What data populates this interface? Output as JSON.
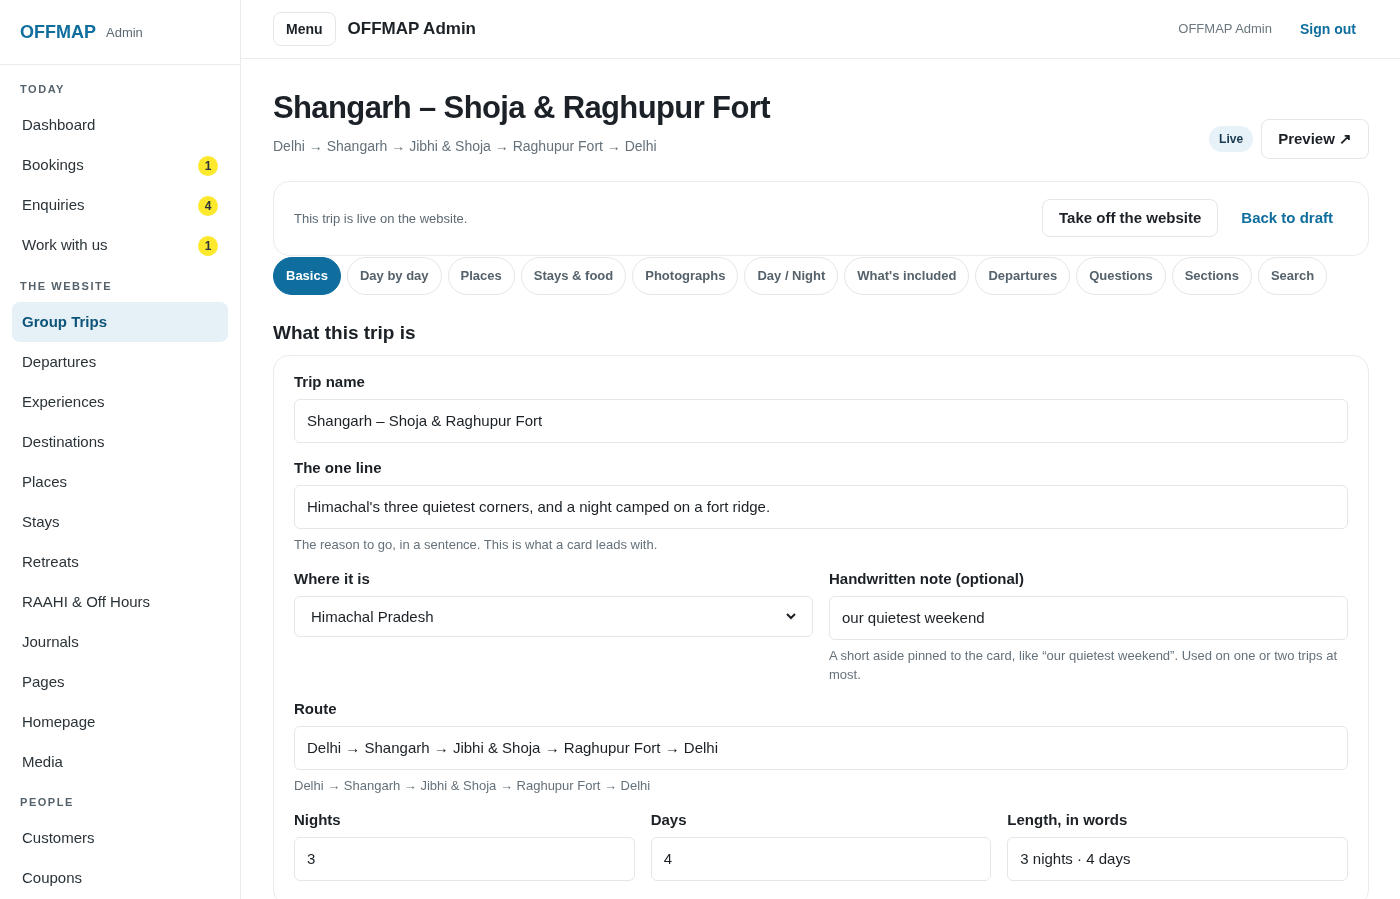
{
  "sidebar": {
    "brand": "OFFMAP",
    "brand_suffix": "Admin",
    "groups": [
      {
        "heading": "TODAY",
        "items": [
          {
            "label": "Dashboard",
            "selected": false
          },
          {
            "label": "Bookings",
            "badge": "1",
            "selected": false
          },
          {
            "label": "Enquiries",
            "badge": "4",
            "selected": false
          },
          {
            "label": "Work with us",
            "badge": "1",
            "selected": false
          }
        ]
      },
      {
        "heading": "THE WEBSITE",
        "items": [
          {
            "label": "Group Trips",
            "selected": true
          },
          {
            "label": "Departures",
            "selected": false
          },
          {
            "label": "Experiences",
            "selected": false
          },
          {
            "label": "Destinations",
            "selected": false
          },
          {
            "label": "Places",
            "selected": false
          },
          {
            "label": "Stays",
            "selected": false
          },
          {
            "label": "Retreats",
            "selected": false
          },
          {
            "label": "RAAHI & Off Hours",
            "selected": false
          },
          {
            "label": "Journals",
            "selected": false
          },
          {
            "label": "Pages",
            "selected": false
          },
          {
            "label": "Homepage",
            "selected": false
          },
          {
            "label": "Media",
            "selected": false
          }
        ]
      },
      {
        "heading": "PEOPLE",
        "items": [
          {
            "label": "Customers",
            "selected": false
          },
          {
            "label": "Coupons",
            "selected": false
          }
        ]
      }
    ]
  },
  "topbar": {
    "menu_button": "Menu",
    "title": "OFFMAP Admin",
    "user": "OFFMAP Admin",
    "sign_out": "Sign out"
  },
  "page": {
    "title": "Shangarh – Shoja & Raghupur Fort",
    "route": "Delhi → Shangarh → Jibhi & Shoja → Raghupur Fort → Delhi",
    "status_badge": "Live",
    "preview_button": "Preview ↗"
  },
  "status_card": {
    "message": "This trip is live on the website.",
    "primary_button": "Take off the website",
    "link_button": "Back to draft"
  },
  "tabs": [
    {
      "label": "Basics",
      "selected": true
    },
    {
      "label": "Day by day",
      "selected": false
    },
    {
      "label": "Places",
      "selected": false
    },
    {
      "label": "Stays & food",
      "selected": false
    },
    {
      "label": "Photographs",
      "selected": false
    },
    {
      "label": "Day / Night",
      "selected": false
    },
    {
      "label": "What's included",
      "selected": false
    },
    {
      "label": "Departures",
      "selected": false
    },
    {
      "label": "Questions",
      "selected": false
    },
    {
      "label": "Sections",
      "selected": false
    },
    {
      "label": "Search",
      "selected": false
    }
  ],
  "section": {
    "heading": "What this trip is",
    "rows": [
      {
        "fields": [
          {
            "kind": "text",
            "label": "Trip name",
            "value": "Shangarh – Shoja & Raghupur Fort"
          }
        ]
      },
      {
        "fields": [
          {
            "kind": "text",
            "label": "The one line",
            "value": "Himachal's three quietest corners, and a night camped on a fort ridge.",
            "hint": "The reason to go, in a sentence. This is what a card leads with."
          }
        ]
      },
      {
        "fields": [
          {
            "kind": "select",
            "label": "Where it is",
            "value": "Himachal Pradesh"
          },
          {
            "kind": "text",
            "label": "Handwritten note (optional)",
            "value": "our quietest weekend",
            "hint": "A short aside pinned to the card, like “our quietest weekend”. Used on one or two trips at most."
          }
        ]
      },
      {
        "fields": [
          {
            "kind": "text",
            "label": "Route",
            "value": "Delhi → Shangarh → Jibhi & Shoja → Raghupur Fort → Delhi",
            "hint": "Delhi → Shangarh → Jibhi & Shoja → Raghupur Fort → Delhi"
          }
        ]
      },
      {
        "fields": [
          {
            "kind": "text",
            "label": "Nights",
            "value": "3"
          },
          {
            "kind": "text",
            "label": "Days",
            "value": "4"
          },
          {
            "kind": "text",
            "label": "Length, in words",
            "value": "3 nights · 4 days"
          }
        ]
      }
    ]
  }
}
